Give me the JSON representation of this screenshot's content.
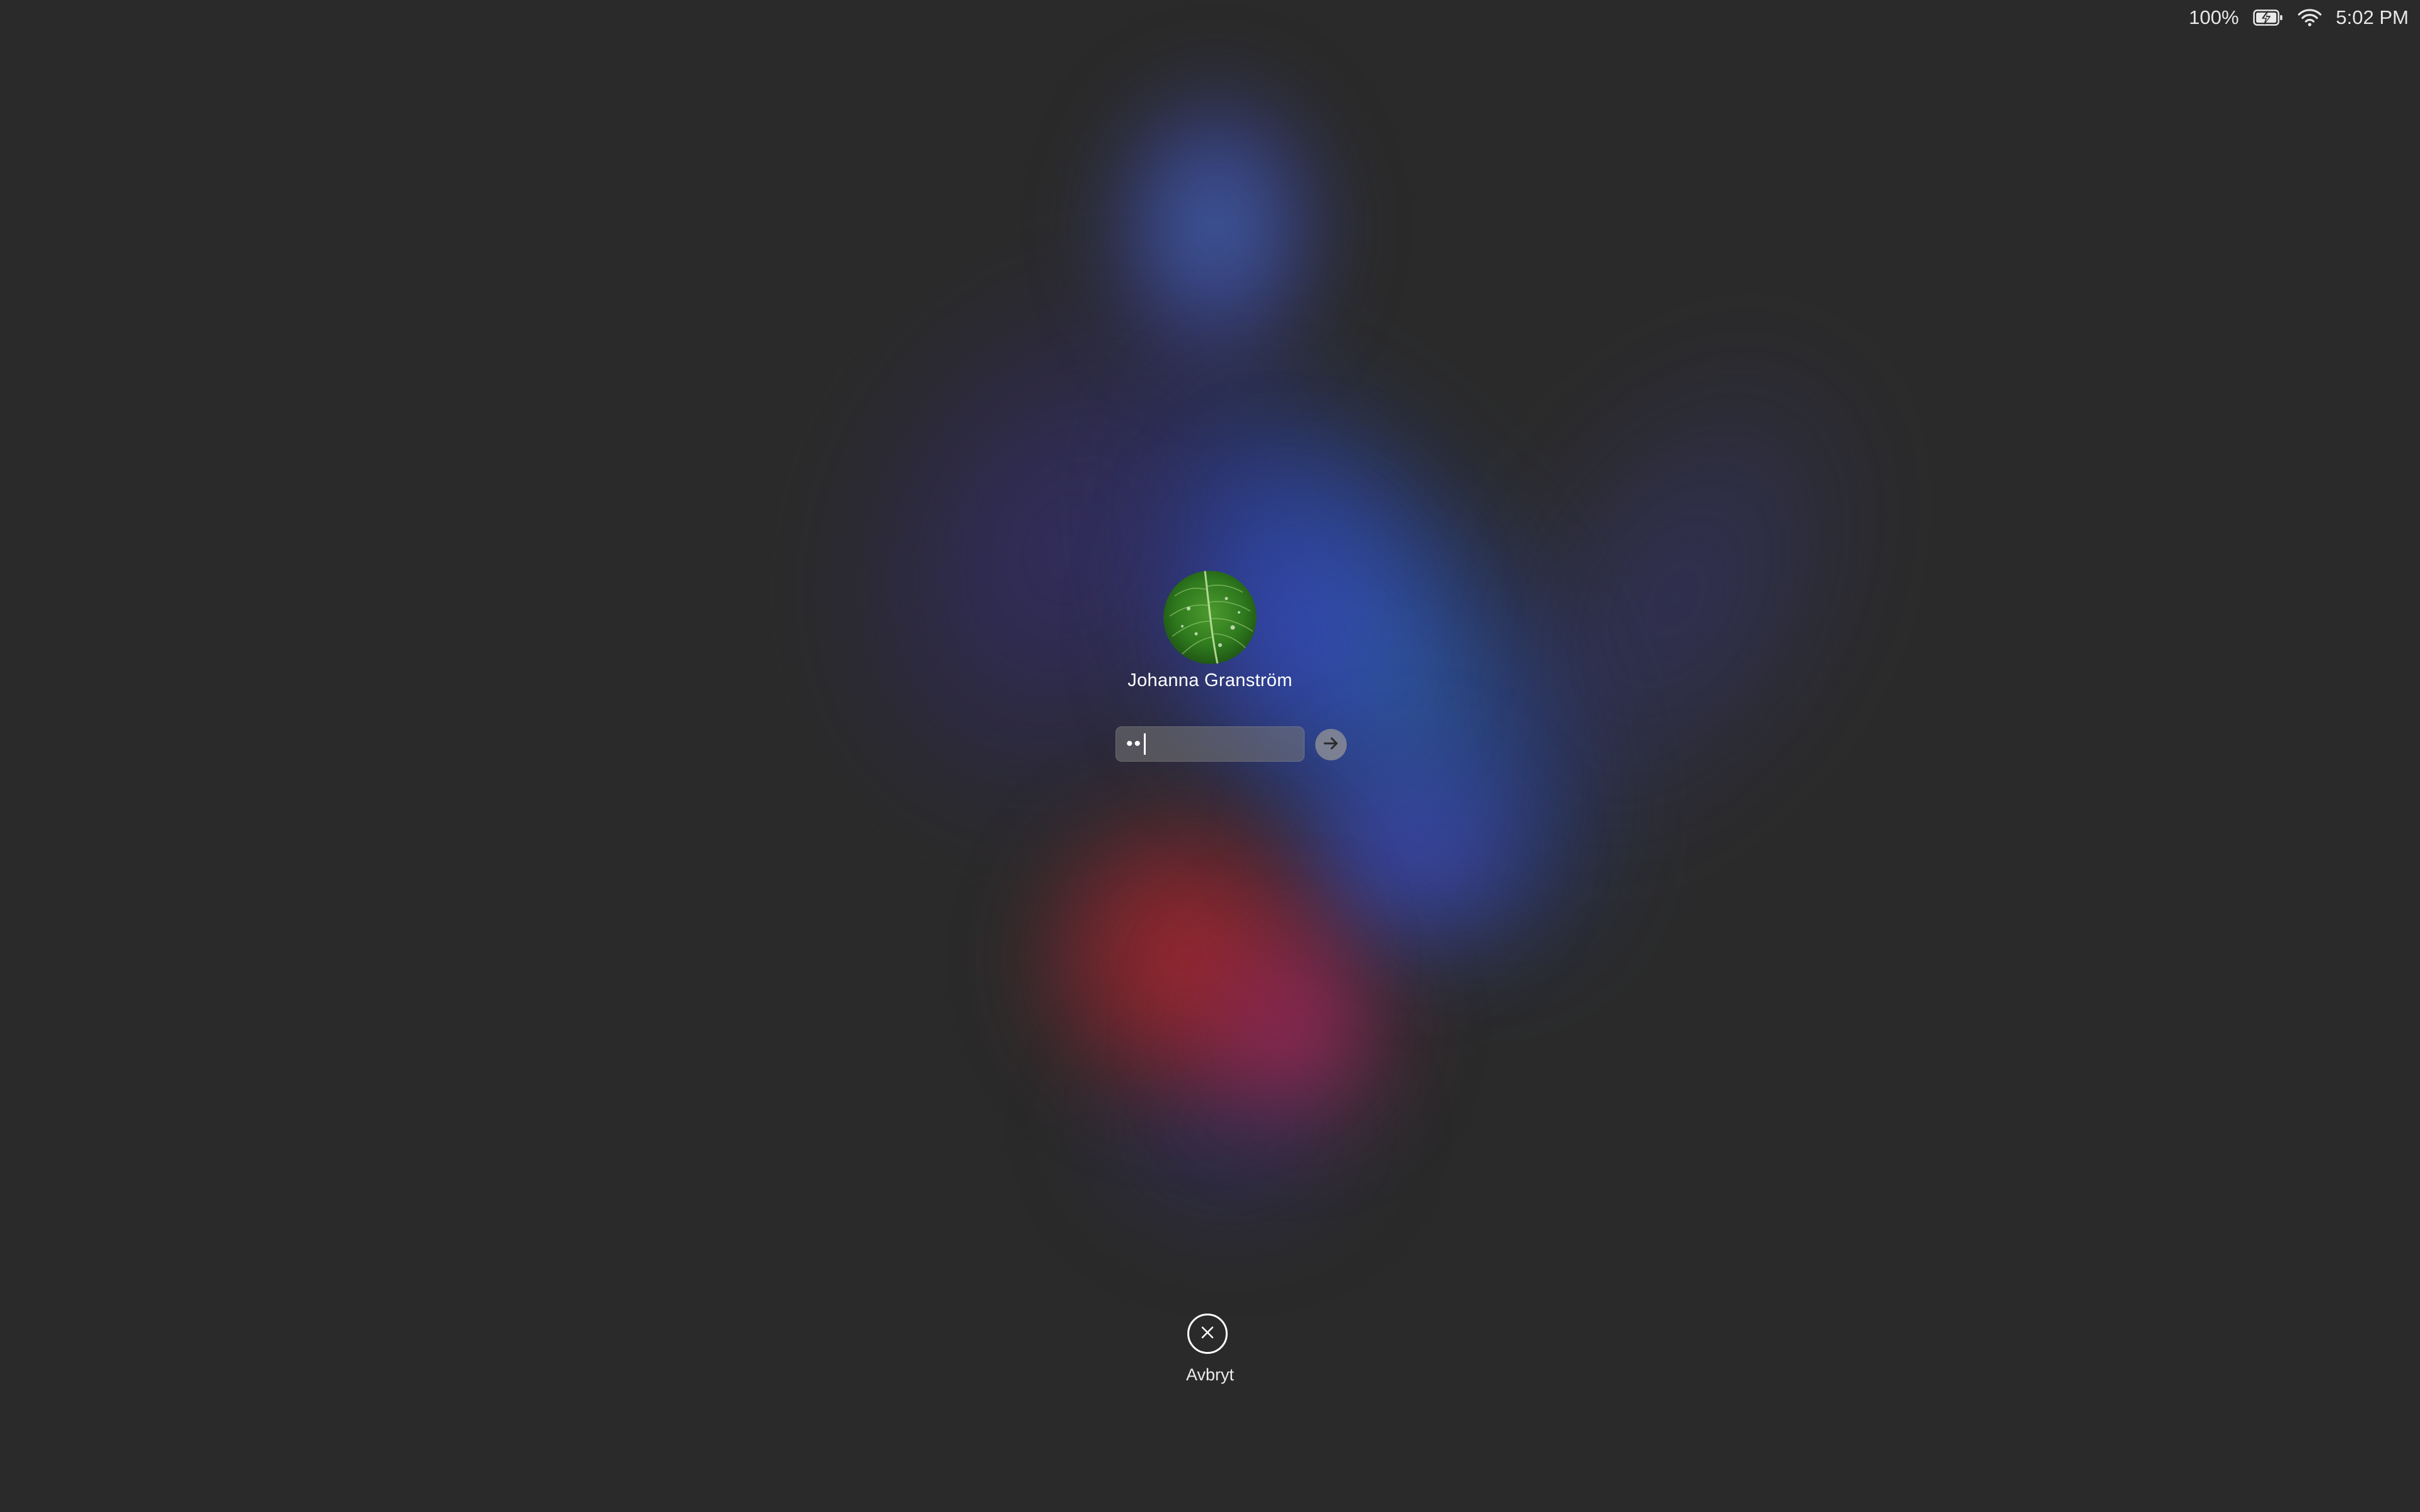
{
  "status_bar": {
    "battery_percent": "100%",
    "battery_icon": "battery-charging-icon",
    "wifi_icon": "wifi-icon",
    "time": "5:02 PM"
  },
  "login": {
    "avatar_icon": "leaf-avatar",
    "user_name": "Johanna Granström",
    "password_value": "••",
    "submit_icon": "arrow-right-icon"
  },
  "cancel": {
    "icon": "close-circle-icon",
    "label": "Avbryt"
  },
  "colors": {
    "background": "#2a2a2a",
    "wallpaper_blue": "#3c5ac8",
    "wallpaper_red": "#b4282d",
    "avatar_green": "#2f7a1e"
  }
}
